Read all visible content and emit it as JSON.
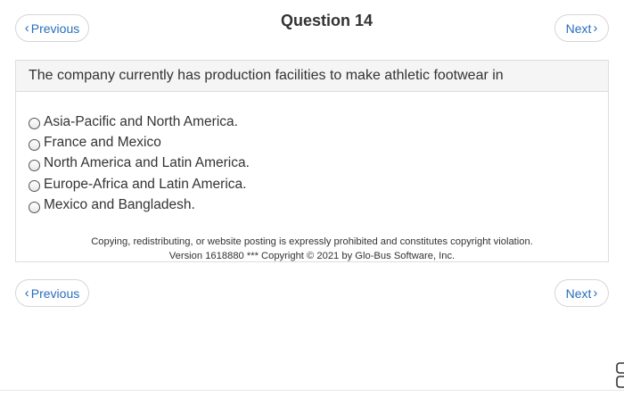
{
  "title": "Question 14",
  "nav": {
    "previous_label": "Previous",
    "next_label": "Next"
  },
  "question": {
    "text": "The company currently has production facilities to make athletic footwear in",
    "options": [
      "Asia-Pacific and North America.",
      "France and Mexico",
      "North America and Latin America.",
      "Europe-Africa and Latin America.",
      "Mexico and Bangladesh."
    ]
  },
  "footer": {
    "notice": "Copying, redistributing, or website posting is expressly prohibited and constitutes copyright violation.",
    "version": "Version 1618880 *** Copyright © 2021 by Glo-Bus Software, Inc."
  },
  "colors": {
    "link": "#2a6ebb",
    "header_bg": "#f5f5f5",
    "border": "#dddddd"
  },
  "icons": [
    "chevron-left-icon",
    "chevron-right-icon",
    "radio-button-icon"
  ]
}
